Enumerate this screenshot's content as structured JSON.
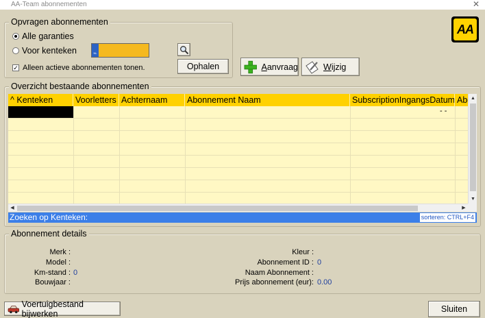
{
  "window": {
    "title": "AA-Team abonnementen",
    "close": "✕"
  },
  "logo": {
    "text": "AA",
    "color": "#ffd200"
  },
  "query": {
    "group_title": "Opvragen abonnementen",
    "radio_all": "Alle garanties",
    "radio_plate": "Voor kenteken",
    "radio_all_selected": true,
    "plate_value": "",
    "plate_eu_label": "NL",
    "checkbox_label": "Alleen actieve abonnementen tonen.",
    "checkbox_checked": true,
    "fetch_button": "Ophalen"
  },
  "actions": {
    "new_first": "A",
    "new_rest": "anvraag",
    "edit_first": "W",
    "edit_rest": "ijzig"
  },
  "overview": {
    "group_title": "Overzicht bestaande abonnementen",
    "sort_arrow": "^",
    "columns": [
      "Kenteken",
      "Voorletters",
      "Achternaam",
      "Abonnement Naam",
      "SubscriptionIngangsDatum",
      "Abo"
    ],
    "first_row_date": "-   -",
    "search_label": "Zoeken op Kenteken:",
    "search_hint": "sorteren: CTRL+F4"
  },
  "details": {
    "group_title": "Abonnement details",
    "left": [
      {
        "label": "Merk :",
        "value": ""
      },
      {
        "label": "Model :",
        "value": ""
      },
      {
        "label": "Km-stand :",
        "value": "0"
      },
      {
        "label": "Bouwjaar :",
        "value": ""
      }
    ],
    "right": [
      {
        "label": "Kleur :",
        "value": ""
      },
      {
        "label": "Abonnement ID :",
        "value": "0"
      },
      {
        "label": "Naam Abonnement :",
        "value": ""
      },
      {
        "label": "Prijs abonnement (eur):",
        "value": "0.00"
      }
    ]
  },
  "footer": {
    "update_vehicles": "Voertuigbestand bijwerken",
    "close_button": "Sluiten"
  }
}
